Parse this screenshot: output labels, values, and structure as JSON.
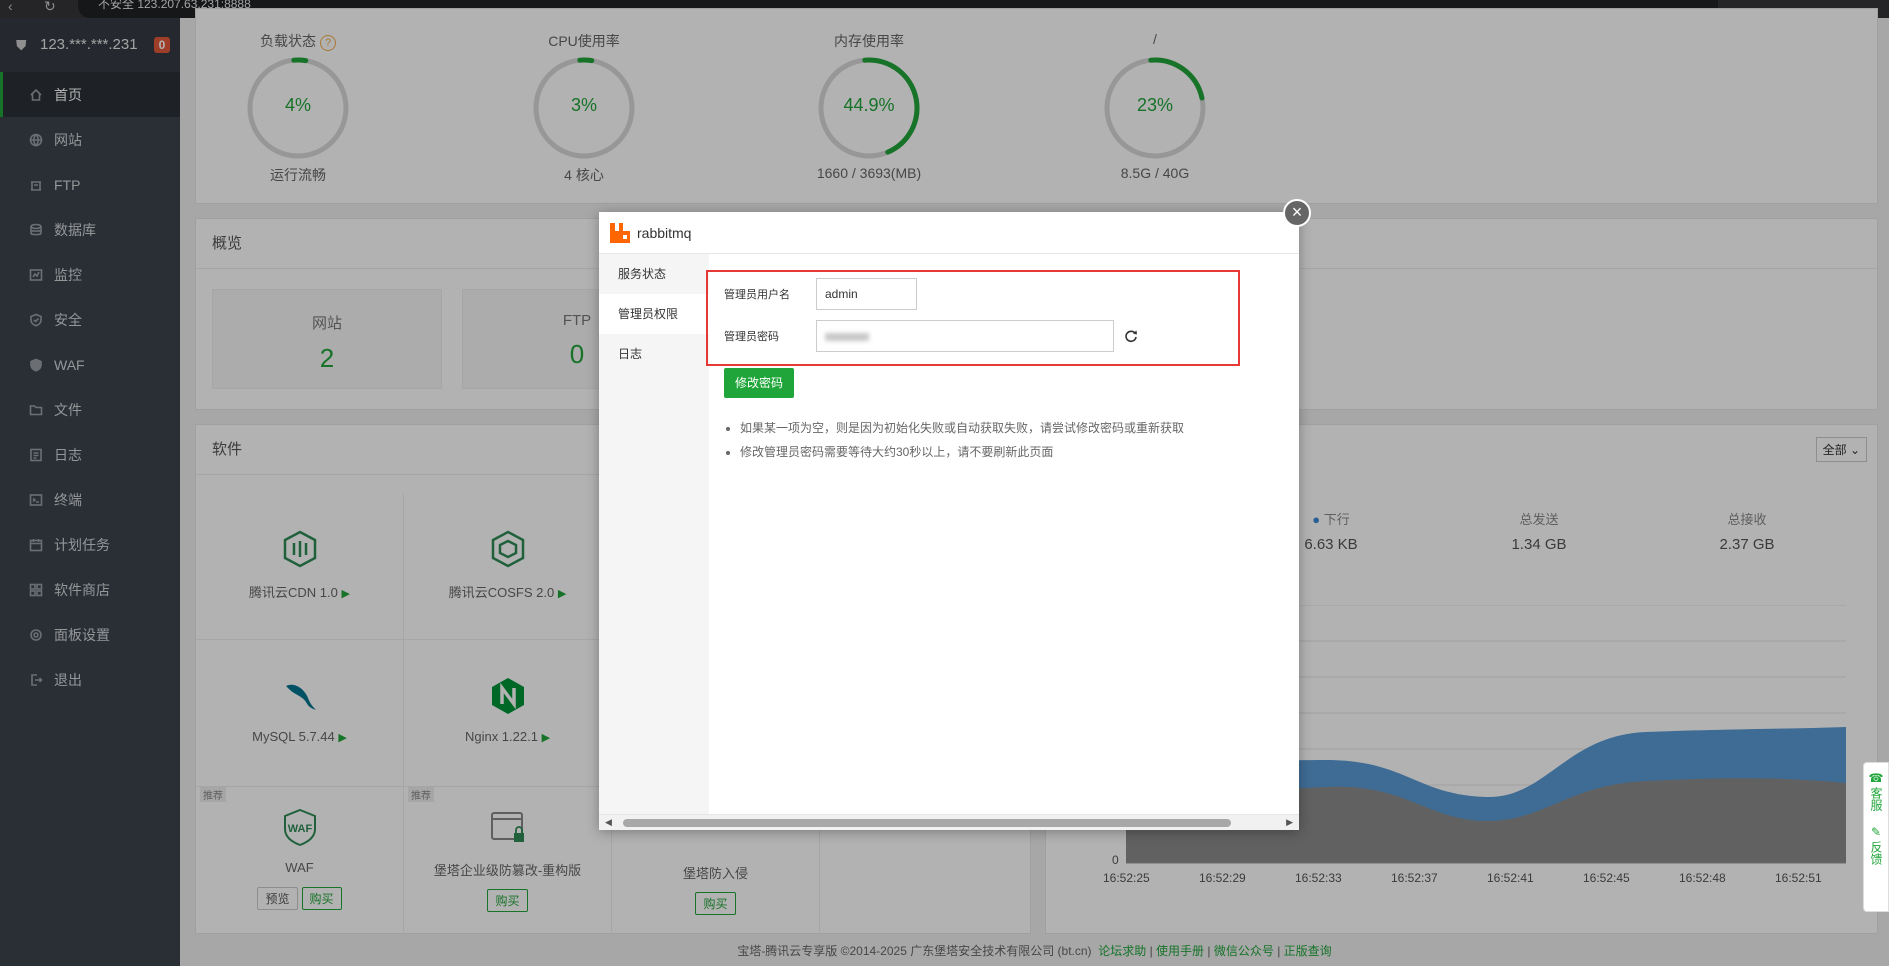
{
  "browser": {
    "url": "不安全  123.207.63.231:8888"
  },
  "sidebar": {
    "server": "123.***.***.231",
    "badge": "0",
    "items": [
      {
        "label": "首页",
        "icon": "home-icon"
      },
      {
        "label": "网站",
        "icon": "globe-icon"
      },
      {
        "label": "FTP",
        "icon": "ftp-icon"
      },
      {
        "label": "数据库",
        "icon": "database-icon"
      },
      {
        "label": "监控",
        "icon": "monitor-icon"
      },
      {
        "label": "安全",
        "icon": "shield-icon"
      },
      {
        "label": "WAF",
        "icon": "waf-icon"
      },
      {
        "label": "文件",
        "icon": "folder-icon"
      },
      {
        "label": "日志",
        "icon": "log-icon"
      },
      {
        "label": "终端",
        "icon": "terminal-icon"
      },
      {
        "label": "计划任务",
        "icon": "calendar-icon"
      },
      {
        "label": "软件商店",
        "icon": "grid-icon"
      },
      {
        "label": "面板设置",
        "icon": "gear-icon"
      },
      {
        "label": "退出",
        "icon": "logout-icon"
      }
    ]
  },
  "gauges": [
    {
      "title": "负载状态",
      "pct": "4%",
      "value": 4,
      "sub": "运行流畅"
    },
    {
      "title": "CPU使用率",
      "pct": "3%",
      "value": 3,
      "sub": "4 核心"
    },
    {
      "title": "内存使用率",
      "pct": "44.9%",
      "value": 44.9,
      "sub": "1660 / 3693(MB)"
    },
    {
      "title": "/",
      "pct": "23%",
      "value": 23,
      "sub": "8.5G / 40G"
    }
  ],
  "overview": {
    "title": "概览",
    "stats": [
      {
        "label": "网站",
        "num": "2"
      },
      {
        "label": "FTP",
        "num": "0"
      }
    ]
  },
  "software": {
    "title": "软件",
    "filter": "全部",
    "items": [
      {
        "name": "腾讯云CDN 1.0"
      },
      {
        "name": "腾讯云COSFS 2.0"
      },
      {
        "name": "MySQL 5.7.44"
      },
      {
        "name": "Nginx 1.22.1"
      },
      {
        "name": "WAF",
        "tag": "推荐",
        "btn1": "预览",
        "btn2": "购买"
      },
      {
        "name": "堡塔企业级防篡改-重构版",
        "tag": "推荐",
        "btn2": "购买"
      },
      {
        "name": "堡塔防入侵",
        "btn2": "购买"
      }
    ]
  },
  "traffic": {
    "items": [
      {
        "label": "下行",
        "value": "6.63 KB"
      },
      {
        "label": "总发送",
        "value": "1.34 GB"
      },
      {
        "label": "总接收",
        "value": "2.37 GB"
      }
    ],
    "y0": "0",
    "x_ticks": [
      "16:52:25",
      "16:52:29",
      "16:52:33",
      "16:52:37",
      "16:52:41",
      "16:52:45",
      "16:52:48",
      "16:52:51"
    ]
  },
  "footer": {
    "copyright": "宝塔-腾讯云专享版 ©2014-2025 广东堡塔安全技术有限公司 (bt.cn)",
    "links": [
      "论坛求助",
      "使用手册",
      "微信公众号",
      "正版查询"
    ]
  },
  "modal": {
    "title": "rabbitmq",
    "tabs": [
      "服务状态",
      "管理员权限",
      "日志"
    ],
    "username_label": "管理员用户名",
    "username_value": "admin",
    "password_label": "管理员密码",
    "change_btn": "修改密码",
    "tips": [
      "如果某一项为空，则是因为初始化失败或自动获取失败，请尝试修改密码或重新获取",
      "修改管理员密码需要等待大约30秒以上，请不要刷新此页面"
    ]
  },
  "side_widget": {
    "service": "客服",
    "feedback": "反馈"
  }
}
